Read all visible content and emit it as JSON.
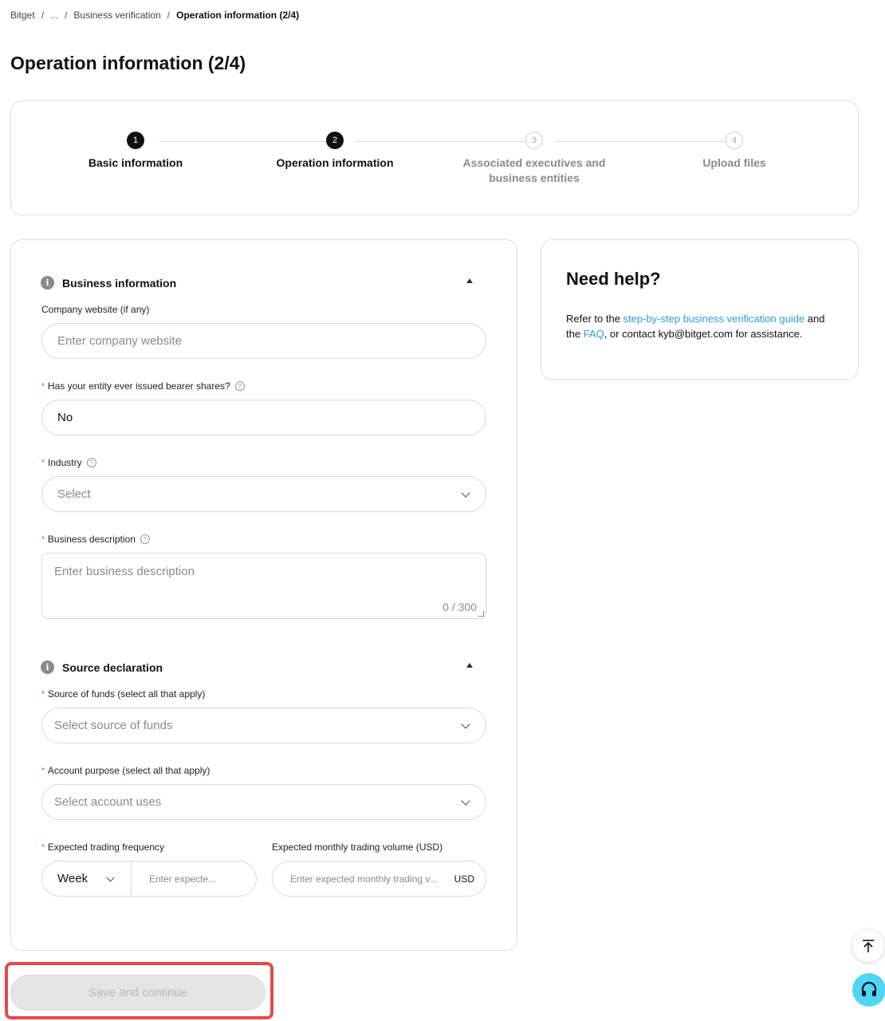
{
  "breadcrumb": {
    "root": "Bitget",
    "ellipsis": "...",
    "parent": "Business verification",
    "current": "Operation information (2/4)",
    "separator": "/"
  },
  "page_title": "Operation information (2/4)",
  "steps": [
    {
      "number": "1",
      "label": "Basic information",
      "state": "done"
    },
    {
      "number": "2",
      "label": "Operation information",
      "state": "active"
    },
    {
      "number": "3",
      "label": "Associated executives and business entities",
      "state": "todo"
    },
    {
      "number": "4",
      "label": "Upload files",
      "state": "todo"
    }
  ],
  "business_section": {
    "title": "Business information",
    "icon": "info-icon",
    "website": {
      "label": "Company website (if any)",
      "placeholder": "Enter company website"
    },
    "bearer_shares": {
      "label": "Has your entity ever issued bearer shares?",
      "value": "No",
      "required": true
    },
    "industry": {
      "label": "Industry",
      "placeholder": "Select",
      "required": true
    },
    "description": {
      "label": "Business description",
      "placeholder": "Enter business description",
      "counter": "0 / 300",
      "required": true
    }
  },
  "source_section": {
    "title": "Source declaration",
    "icon": "info-icon",
    "funds": {
      "label": "Source of funds (select all that apply)",
      "placeholder": "Select source of funds",
      "required": true
    },
    "purpose": {
      "label": "Account purpose (select all that apply)",
      "placeholder": "Select account uses",
      "required": true
    },
    "frequency": {
      "label": "Expected trading frequency",
      "period": "Week",
      "placeholder": "Enter expecte...",
      "required": true
    },
    "volume": {
      "label": "Expected monthly trading volume (USD)",
      "placeholder": "Enter expected monthly trading v...",
      "unit": "USD"
    }
  },
  "help": {
    "title": "Need help?",
    "text_1": "Refer to the ",
    "link_guide": "step-by-step business verification guide",
    "text_2": " and the ",
    "link_faq": "FAQ",
    "text_3": ", or contact kyb@bitget.com for assistance."
  },
  "save_button": "Save and continue",
  "colors": {
    "accent_link": "#2a9fd6",
    "required": "#e2443b",
    "highlight": "#e9474a",
    "support": "#4fd6f4"
  }
}
